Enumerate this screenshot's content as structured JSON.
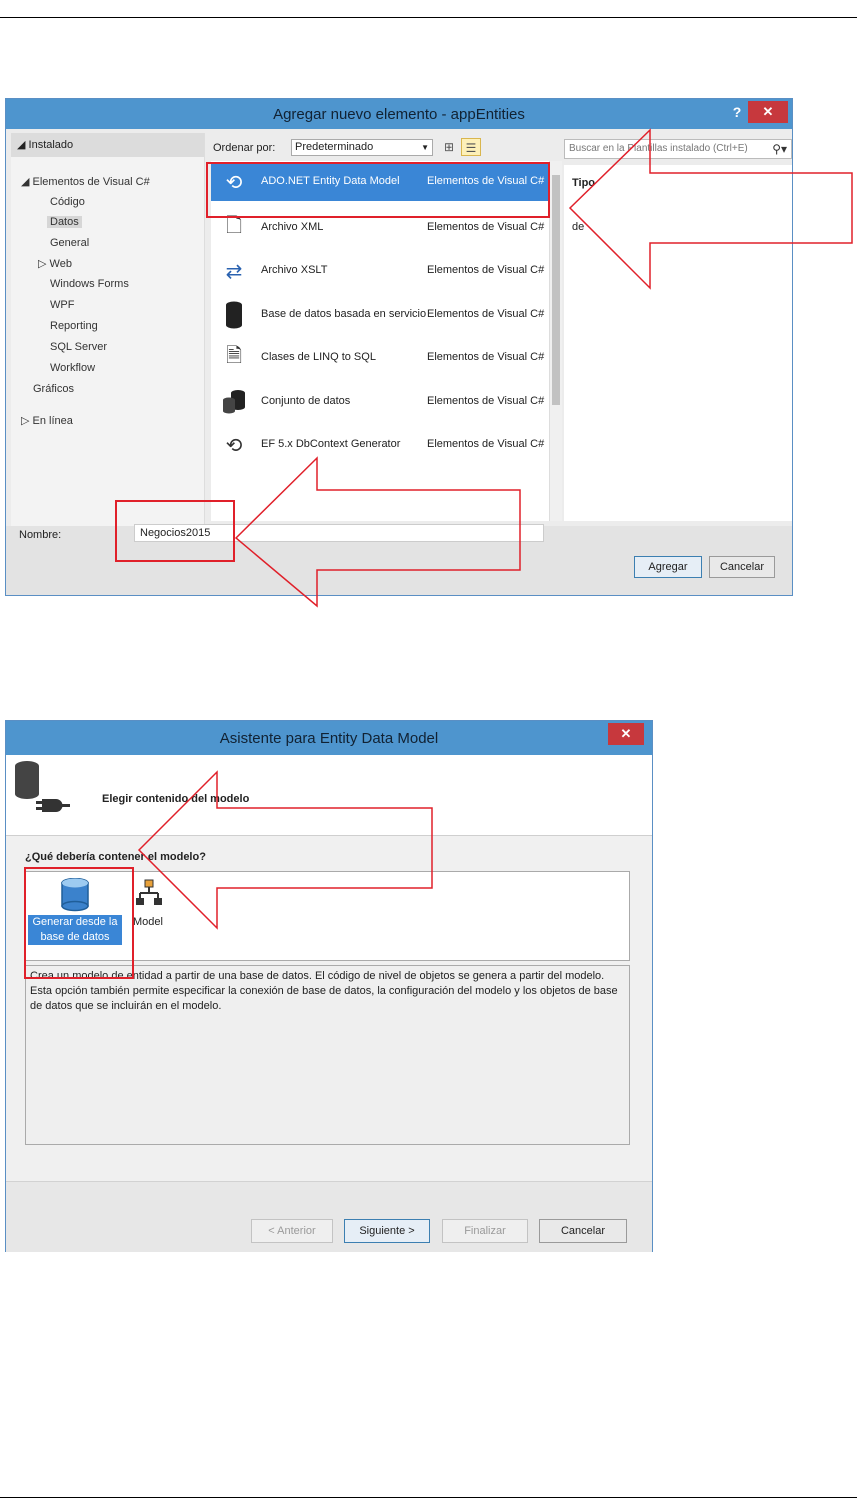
{
  "dialog1": {
    "title": "Agregar nuevo elemento - appEntities",
    "help": "?",
    "close": "✕",
    "tree_header": "◢ Instalado",
    "tree_items": [
      "◢ Elementos de Visual C#",
      "Código",
      "Datos",
      "General",
      "▷ Web",
      "Windows Forms",
      "WPF",
      "Reporting",
      "SQL Server",
      "Workflow",
      "Gráficos",
      "▷ En línea"
    ],
    "sort_label": "Ordenar por:",
    "sort_value": "Predeterminado",
    "search_placeholder": "Buscar en la Plantillas instalado (Ctrl+E)",
    "items": [
      {
        "name": "ADO.NET Entity Data Model",
        "category": "Elementos de Visual C#",
        "icon": "entity-model-icon"
      },
      {
        "name": "Archivo XML",
        "category": "Elementos de Visual C#",
        "icon": "xml-file-icon"
      },
      {
        "name": "Archivo XSLT",
        "category": "Elementos de Visual C#",
        "icon": "xslt-file-icon"
      },
      {
        "name": "Base de datos basada en servicio",
        "category": "Elementos de Visual C#",
        "icon": "database-icon"
      },
      {
        "name": "Clases de LINQ to SQL",
        "category": "Elementos de Visual C#",
        "icon": "linq-icon"
      },
      {
        "name": "Conjunto de datos",
        "category": "Elementos de Visual C#",
        "icon": "dataset-icon"
      },
      {
        "name": "EF 5.x DbContext Generator",
        "category": "Elementos de Visual C#",
        "icon": "ef-generator-icon"
      }
    ],
    "type_label": "Tipo",
    "type_value": "de",
    "name_label": "Nombre:",
    "name_value": "Negocios2015",
    "add_button": "Agregar",
    "cancel_button": "Cancelar"
  },
  "dialog2": {
    "title": "Asistente para Entity Data Model",
    "close": "✕",
    "header_title": "Elegir contenido del modelo",
    "question": "¿Qué debería contener el modelo?",
    "options": [
      {
        "label": "Generar desde la base de datos",
        "icon": "database-icon"
      },
      {
        "label": "Model",
        "icon": "empty-model-icon"
      }
    ],
    "description": "Crea un modelo de entidad a partir de una base de datos. El código de nivel de objetos se genera a partir del modelo. Esta opción también permite especificar la conexión de base de datos, la configuración del modelo y los objetos de base de datos que se incluirán en el modelo.",
    "buttons": {
      "previous": "< Anterior",
      "next": "Siguiente >",
      "finish": "Finalizar",
      "cancel": "Cancelar"
    }
  },
  "colors": {
    "titlebar": "#4e95ce",
    "close": "#c7383d",
    "selection": "#3a86d6",
    "highlight": "#e0202a"
  }
}
